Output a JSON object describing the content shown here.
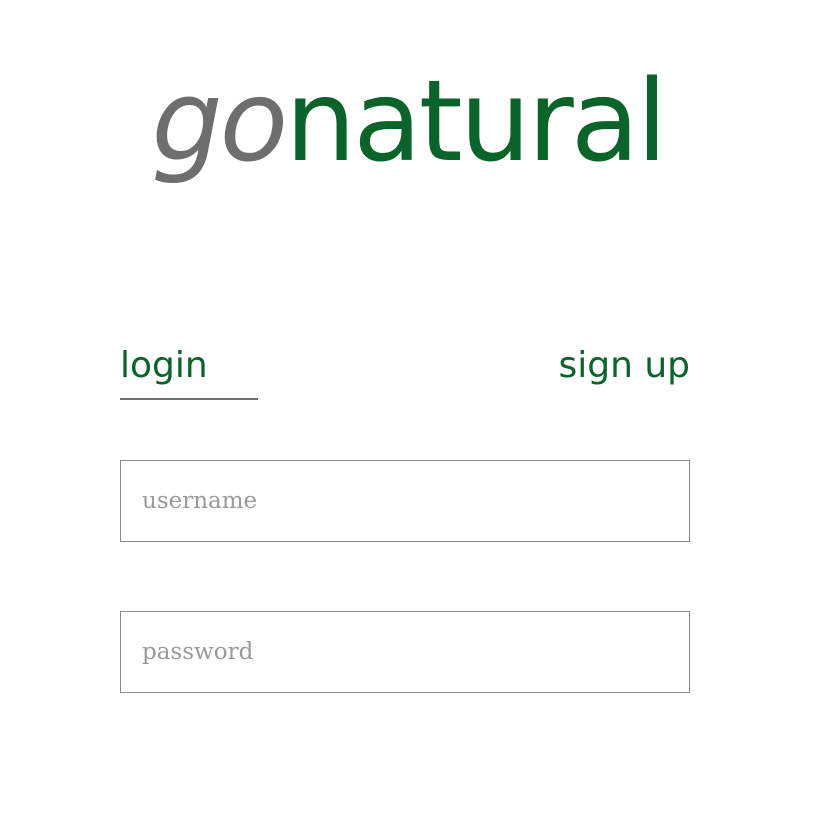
{
  "logo": {
    "prefix": "go",
    "suffix": "natural"
  },
  "colors": {
    "brand_green": "#0a6328",
    "logo_gray": "#6e6e6e",
    "border_gray": "#8a8a8a",
    "placeholder_gray": "#9a9a9a"
  },
  "tabs": {
    "login_label": "login",
    "signup_label": "sign up",
    "active": "login"
  },
  "form": {
    "username": {
      "placeholder": "username",
      "value": ""
    },
    "password": {
      "placeholder": "password",
      "value": ""
    }
  }
}
